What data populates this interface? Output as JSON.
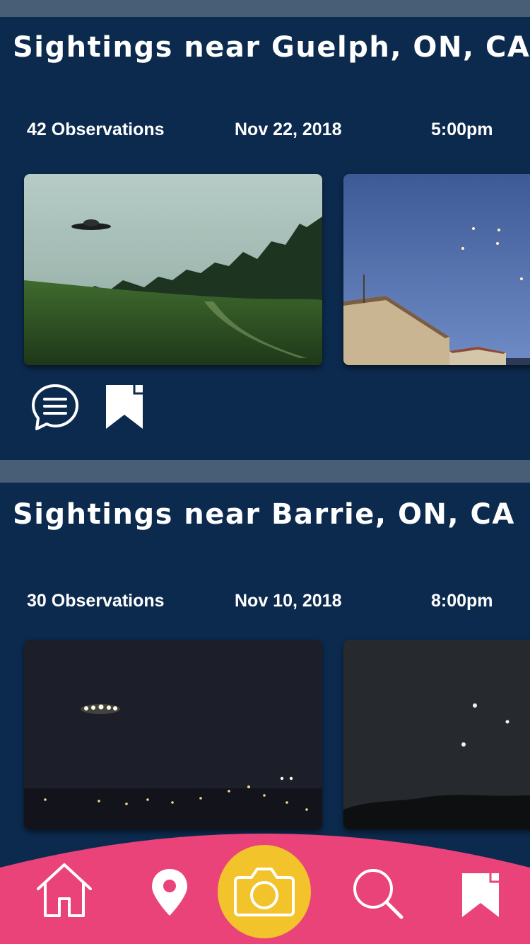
{
  "cards": [
    {
      "title": "Sightings near Guelph, ON, CA",
      "observations": "42 Observations",
      "date": "Nov 22, 2018",
      "time": "5:00pm"
    },
    {
      "title": "Sightings near Barrie, ON, CA",
      "observations": "30 Observations",
      "date": "Nov 10, 2018",
      "time": "8:00pm"
    }
  ],
  "icons": {
    "comment": "comment-icon",
    "bookmark": "bookmark-icon",
    "home": "home-icon",
    "location": "location-pin-icon",
    "camera": "camera-icon",
    "search": "search-icon"
  },
  "colors": {
    "background": "#0c2a4e",
    "divider": "#485e76",
    "nav_bar": "#ea4379",
    "camera_button": "#f3c32c"
  }
}
